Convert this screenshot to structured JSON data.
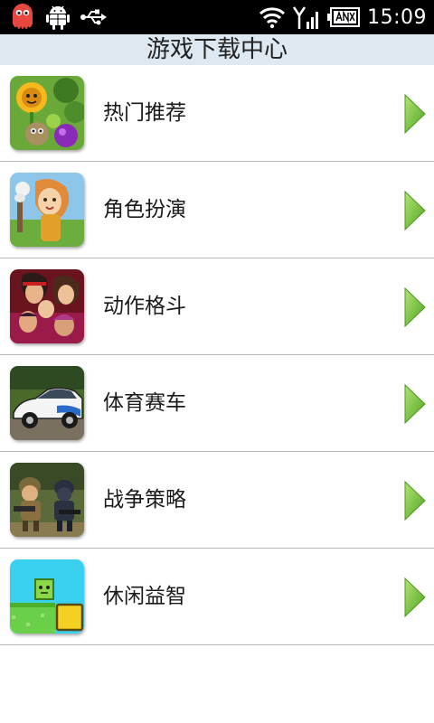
{
  "status_bar": {
    "time": "15:09",
    "icons": [
      "octopus-app-icon",
      "android-debug-icon",
      "usb-icon",
      "wifi-icon",
      "signal-icon",
      "battery-icon"
    ]
  },
  "header": {
    "title": "游戏下载中心"
  },
  "categories": [
    {
      "label": "热门推荐",
      "thumb_icon": "plants-vs-zombies-thumbnail",
      "arrow_icon": "chevron-right-icon"
    },
    {
      "label": "角色扮演",
      "thumb_icon": "rpg-girl-thumbnail",
      "arrow_icon": "chevron-right-icon"
    },
    {
      "label": "动作格斗",
      "thumb_icon": "fighters-thumbnail",
      "arrow_icon": "chevron-right-icon"
    },
    {
      "label": "体育赛车",
      "thumb_icon": "race-car-thumbnail",
      "arrow_icon": "chevron-right-icon"
    },
    {
      "label": "战争策略",
      "thumb_icon": "soldiers-thumbnail",
      "arrow_icon": "chevron-right-icon"
    },
    {
      "label": "休闲益智",
      "thumb_icon": "puzzle-blocks-thumbnail",
      "arrow_icon": "chevron-right-icon"
    }
  ],
  "colors": {
    "status_bar_bg": "#000000",
    "title_bar_bg": "#dde8f1",
    "arrow_green": "#7cc43a",
    "divider": "#b5b5b5"
  }
}
